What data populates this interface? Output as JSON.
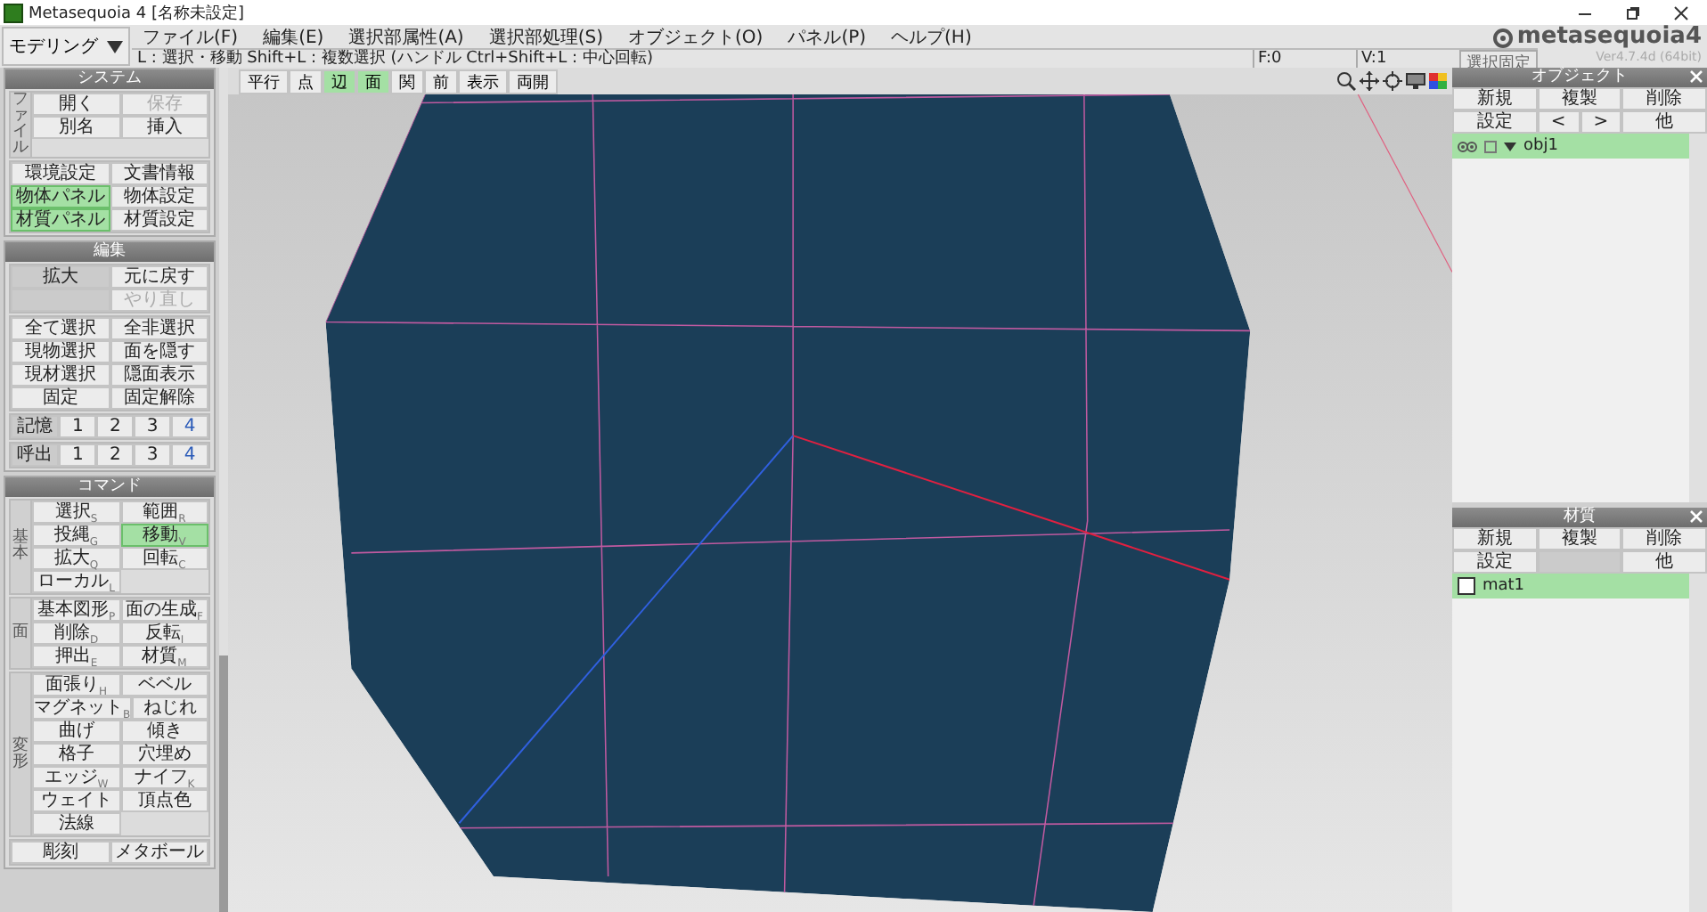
{
  "window": {
    "title": "Metasequoia 4 [名称未設定]"
  },
  "mode": {
    "label": "モデリング"
  },
  "menu": [
    "ファイル(F)",
    "編集(E)",
    "選択部属性(A)",
    "選択部処理(S)",
    "オブジェクト(O)",
    "パネル(P)",
    "ヘルプ(H)"
  ],
  "status": {
    "hint": "L : 選択・移動  Shift+L : 複数選択 (ハンドル  Ctrl+Shift+L : 中心回転)",
    "face_count": "F:0",
    "vertex_count": "V:1",
    "lock_button": "選択固定"
  },
  "logo": {
    "name": "metasequoia4",
    "version": "Ver4.7.4d (64bit)"
  },
  "view_toolbar": [
    {
      "label": "平行",
      "kind": "normal"
    },
    {
      "label": "点",
      "kind": "normal"
    },
    {
      "label": "辺",
      "kind": "on"
    },
    {
      "label": "面",
      "kind": "on"
    },
    {
      "label": "関",
      "kind": "normal"
    },
    {
      "label": "前",
      "kind": "normal"
    },
    {
      "label": "表示",
      "kind": "normal"
    },
    {
      "label": "両開",
      "kind": "normal"
    }
  ],
  "left_panels": [
    {
      "title": "システム",
      "groups": [
        {
          "label": "ファイル",
          "rows": [
            [
              {
                "text": "開く",
                "kind": "normal"
              },
              {
                "text": "保存",
                "kind": "off"
              }
            ],
            [
              {
                "text": "別名",
                "kind": "normal"
              },
              {
                "text": "挿入",
                "kind": "normal"
              }
            ]
          ]
        },
        {
          "rows": [
            [
              {
                "text": "環境設定",
                "kind": "normal"
              },
              {
                "text": "文書情報",
                "kind": "normal"
              }
            ],
            [
              {
                "text": "物体パネル",
                "kind": "on"
              },
              {
                "text": "物体設定",
                "kind": "normal"
              }
            ],
            [
              {
                "text": "材質パネル",
                "kind": "on"
              },
              {
                "text": "材質設定",
                "kind": "normal"
              }
            ]
          ]
        }
      ]
    },
    {
      "title": "編集",
      "groups": [
        {
          "rows": [
            [
              {
                "text": "拡大",
                "kind": "dark"
              },
              {
                "text": "元に戻す",
                "kind": "normal"
              }
            ],
            [
              {
                "kind": "blank"
              },
              {
                "text": "やり直し",
                "kind": "off"
              }
            ]
          ]
        },
        {
          "rows": [
            [
              {
                "text": "全て選択",
                "kind": "normal"
              },
              {
                "text": "全非選択",
                "kind": "normal"
              }
            ],
            [
              {
                "text": "現物選択",
                "kind": "normal"
              },
              {
                "text": "面を隠す",
                "kind": "normal"
              }
            ],
            [
              {
                "text": "現材選択",
                "kind": "normal"
              },
              {
                "text": "隠面表示",
                "kind": "normal"
              }
            ],
            [
              {
                "text": "固定",
                "kind": "normal"
              },
              {
                "text": "固定解除",
                "kind": "normal"
              }
            ]
          ]
        },
        {
          "rows": [
            [
              {
                "text": "記憶",
                "kind": "dark"
              },
              {
                "text": "1",
                "kind": "normal"
              },
              {
                "text": "2",
                "kind": "normal"
              },
              {
                "text": "3",
                "kind": "normal"
              },
              {
                "text": "4",
                "kind": "mark"
              }
            ]
          ]
        },
        {
          "rows": [
            [
              {
                "text": "呼出",
                "kind": "dark"
              },
              {
                "text": "1",
                "kind": "normal"
              },
              {
                "text": "2",
                "kind": "normal"
              },
              {
                "text": "3",
                "kind": "normal"
              },
              {
                "text": "4",
                "kind": "mark"
              }
            ]
          ]
        }
      ]
    },
    {
      "title": "コマンド",
      "groups": [
        {
          "label": "基本",
          "rows": [
            [
              {
                "text": "選択",
                "shortcut": "S",
                "kind": "normal"
              },
              {
                "text": "範囲",
                "shortcut": "R",
                "kind": "normal"
              }
            ],
            [
              {
                "text": "投縄",
                "shortcut": "G",
                "kind": "normal"
              },
              {
                "text": "移動",
                "shortcut": "V",
                "kind": "on"
              }
            ],
            [
              {
                "text": "拡大",
                "shortcut": "Q",
                "kind": "normal"
              },
              {
                "text": "回転",
                "shortcut": "C",
                "kind": "normal"
              }
            ],
            [
              {
                "text": "ローカル",
                "shortcut": "L",
                "kind": "normal"
              }
            ]
          ]
        },
        {
          "label": "面",
          "rows": [
            [
              {
                "text": "基本図形",
                "shortcut": "P",
                "kind": "normal"
              },
              {
                "text": "面の生成",
                "shortcut": "F",
                "kind": "normal"
              }
            ],
            [
              {
                "text": "削除",
                "shortcut": "D",
                "kind": "normal"
              },
              {
                "text": "反転",
                "shortcut": "I",
                "kind": "normal"
              }
            ],
            [
              {
                "text": "押出",
                "shortcut": "E",
                "kind": "normal"
              },
              {
                "text": "材質",
                "shortcut": "M",
                "kind": "normal"
              }
            ]
          ]
        },
        {
          "label": "変形",
          "rows": [
            [
              {
                "text": "面張り",
                "shortcut": "H",
                "kind": "normal"
              },
              {
                "text": "ベベル",
                "kind": "normal"
              }
            ],
            [
              {
                "text": "マグネット",
                "shortcut": "B",
                "kind": "normal"
              },
              {
                "text": "ねじれ",
                "kind": "normal"
              }
            ],
            [
              {
                "text": "曲げ",
                "kind": "normal"
              },
              {
                "text": "傾き",
                "kind": "normal"
              }
            ],
            [
              {
                "text": "格子",
                "kind": "normal"
              },
              {
                "text": "穴埋め",
                "kind": "normal"
              }
            ],
            [
              {
                "text": "エッジ",
                "shortcut": "W",
                "kind": "normal"
              },
              {
                "text": "ナイフ",
                "shortcut": "K",
                "kind": "normal"
              }
            ],
            [
              {
                "text": "ウェイト",
                "kind": "normal"
              },
              {
                "text": "頂点色",
                "kind": "normal"
              }
            ],
            [
              {
                "text": "法線",
                "kind": "normal"
              }
            ]
          ]
        },
        {
          "rows": [
            [
              {
                "text": "彫刻",
                "kind": "normal"
              },
              {
                "text": "メタボール",
                "kind": "normal"
              }
            ]
          ]
        }
      ]
    }
  ],
  "object_panel": {
    "title": "オブジェクト",
    "buttons": [
      [
        {
          "text": "新規",
          "kind": "normal"
        },
        {
          "text": "複製",
          "kind": "normal"
        },
        {
          "text": "削除",
          "kind": "normal"
        }
      ],
      [
        {
          "text": "設定",
          "kind": "normal"
        },
        {
          "text": "<",
          "kind": "normal"
        },
        {
          "text": ">",
          "kind": "normal"
        },
        {
          "text": "他",
          "kind": "normal"
        }
      ]
    ],
    "items": [
      {
        "name": "obj1",
        "selected": true,
        "visible": true,
        "expanded": true
      }
    ]
  },
  "material_panel": {
    "title": "材質",
    "buttons": [
      [
        {
          "text": "新規",
          "kind": "normal"
        },
        {
          "text": "複製",
          "kind": "normal"
        },
        {
          "text": "削除",
          "kind": "normal"
        }
      ],
      [
        {
          "text": "設定",
          "kind": "normal"
        },
        {
          "kind": "blank"
        },
        {
          "text": "他",
          "kind": "normal"
        }
      ]
    ],
    "items": [
      {
        "name": "mat1",
        "selected": true
      }
    ]
  }
}
